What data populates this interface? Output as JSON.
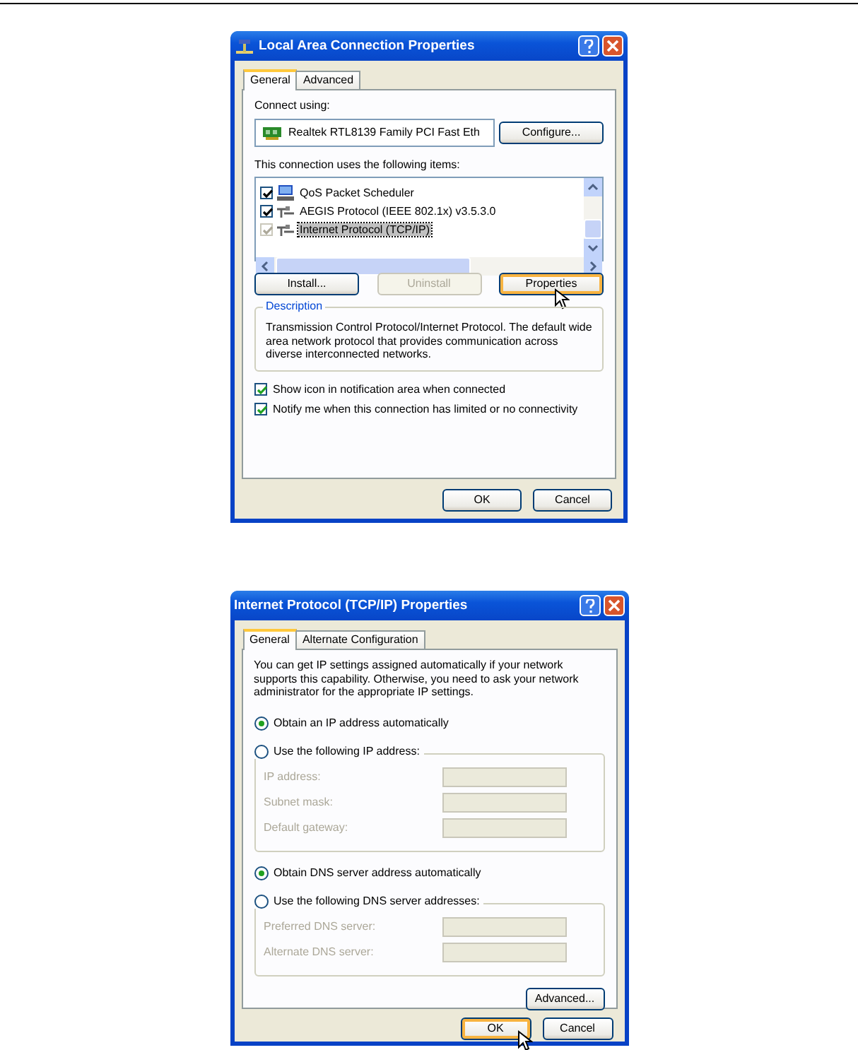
{
  "connection_dialog": {
    "title": "Local Area Connection Properties",
    "tabs": [
      {
        "label": "General",
        "selected": true
      },
      {
        "label": "Advanced",
        "selected": false
      }
    ],
    "connect_using_label": "Connect using:",
    "adapter": "Realtek RTL8139 Family PCI Fast Eth",
    "configure_button": "Configure...",
    "items_label": "This connection uses the following items:",
    "items": [
      {
        "label": "QoS Packet Scheduler",
        "checked": true,
        "disabled": false,
        "selected": false,
        "kind": "scheduler"
      },
      {
        "label": "AEGIS Protocol (IEEE 802.1x) v3.5.3.0",
        "checked": true,
        "disabled": false,
        "selected": false,
        "kind": "protocol"
      },
      {
        "label": "Internet Protocol (TCP/IP)",
        "checked": true,
        "disabled": true,
        "selected": true,
        "kind": "protocol"
      }
    ],
    "item_buttons": [
      {
        "label": "Install...",
        "disabled": false,
        "focused": false
      },
      {
        "label": "Uninstall",
        "disabled": true,
        "focused": false
      },
      {
        "label": "Properties",
        "disabled": false,
        "focused": true
      }
    ],
    "description_legend": "Description",
    "description_text": "Transmission Control Protocol/Internet Protocol. The default wide area network protocol that provides communication across diverse interconnected networks.",
    "options": [
      {
        "label": "Show icon in notification area when connected",
        "checked": true
      },
      {
        "label": "Notify me when this connection has limited or no connectivity",
        "checked": true
      }
    ],
    "footer_buttons": [
      {
        "label": "OK",
        "focused": false
      },
      {
        "label": "Cancel",
        "focused": false
      }
    ]
  },
  "tcpip_dialog": {
    "title": "Internet Protocol (TCP/IP) Properties",
    "tabs": [
      {
        "label": "General",
        "selected": true
      },
      {
        "label": "Alternate Configuration",
        "selected": false
      }
    ],
    "intro": "You can get IP settings assigned automatically if your network supports this capability. Otherwise, you need to ask your network administrator for the appropriate IP settings.",
    "ip_auto": {
      "label": "Obtain an IP address automatically",
      "selected": true
    },
    "ip_manual": {
      "label": "Use the following IP address:",
      "selected": false
    },
    "ip_fields": [
      {
        "label": "IP address:",
        "disabled": true
      },
      {
        "label": "Subnet mask:",
        "disabled": true
      },
      {
        "label": "Default gateway:",
        "disabled": true
      }
    ],
    "dns_auto": {
      "label": "Obtain DNS server address automatically",
      "selected": true
    },
    "dns_manual": {
      "label": "Use the following DNS server addresses:",
      "selected": false
    },
    "dns_fields": [
      {
        "label": "Preferred DNS server:",
        "disabled": true
      },
      {
        "label": "Alternate DNS server:",
        "disabled": true
      }
    ],
    "advanced_button": "Advanced...",
    "footer_buttons": [
      {
        "label": "OK",
        "focused": true
      },
      {
        "label": "Cancel",
        "focused": false
      }
    ]
  }
}
